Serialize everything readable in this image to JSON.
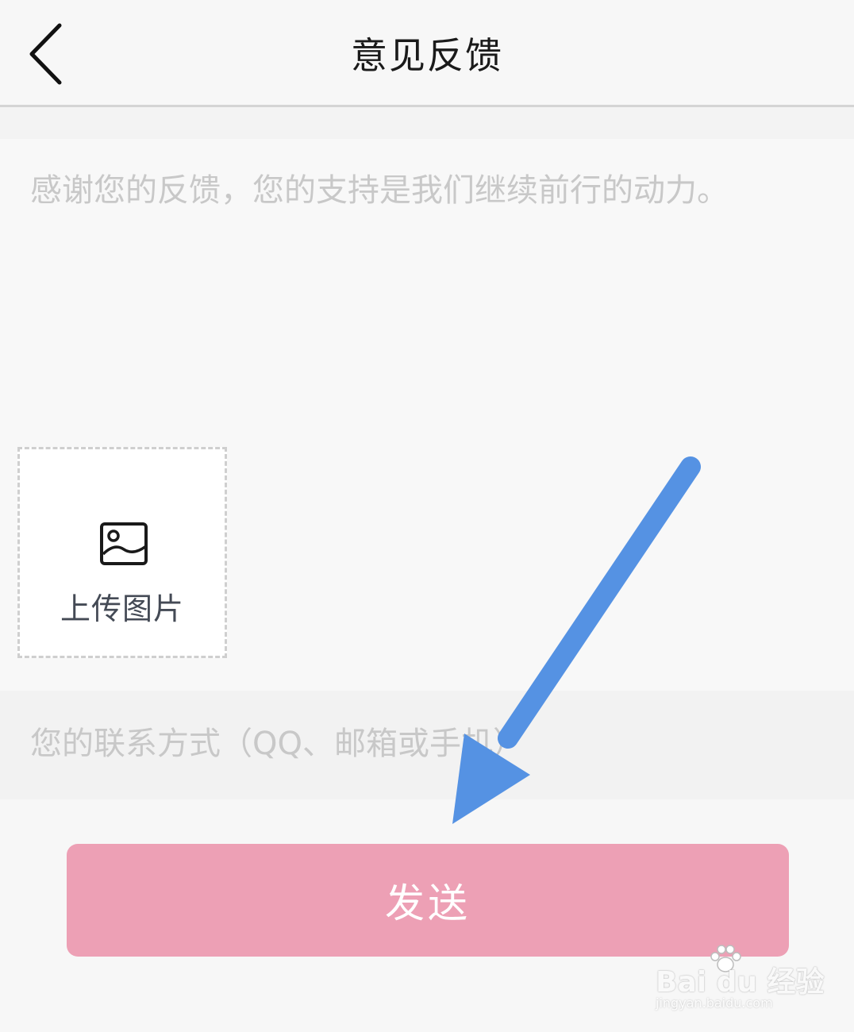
{
  "header": {
    "title": "意见反馈",
    "back_icon": "chevron-left-icon"
  },
  "feedback": {
    "placeholder": "感谢您的反馈，您的支持是我们继续前行的动力。",
    "value": ""
  },
  "upload": {
    "icon": "image-icon",
    "label": "上传图片"
  },
  "contact": {
    "placeholder": "您的联系方式（QQ、邮箱或手机）",
    "value": ""
  },
  "actions": {
    "send_label": "发送"
  },
  "colors": {
    "send_button": "#eda0b5",
    "annotation_arrow": "#5592e3"
  },
  "watermark": {
    "brand": "Bai du 经验",
    "url": "jingyan.baidu.com"
  }
}
